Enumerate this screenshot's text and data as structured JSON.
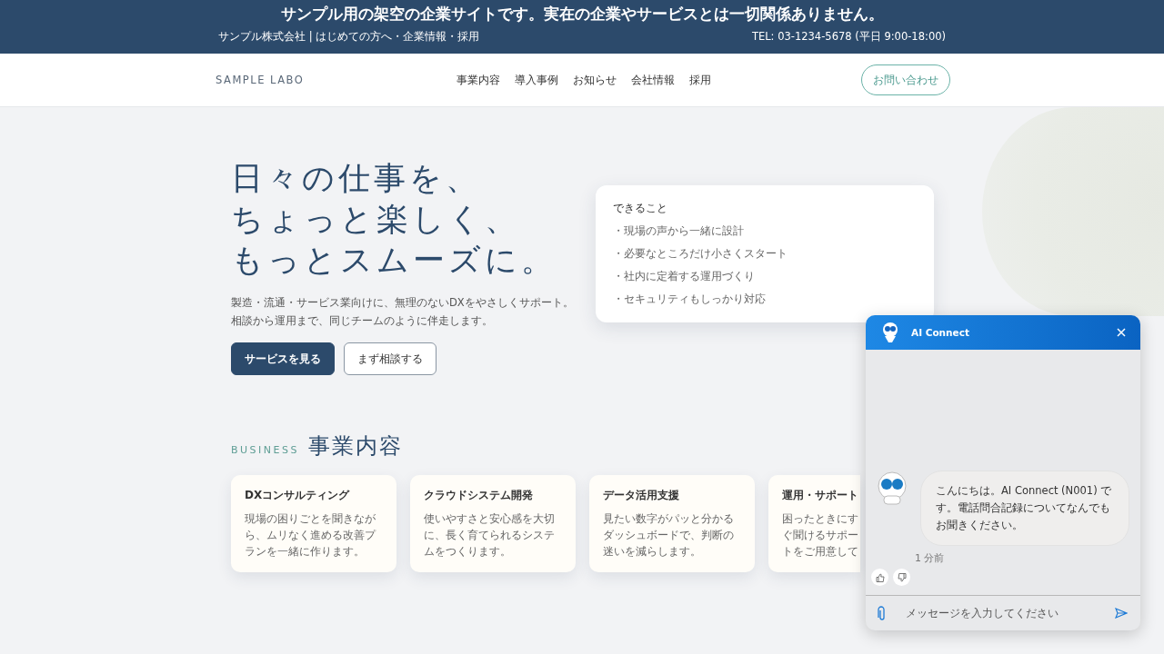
{
  "notice_banner": {
    "text": "サンプル用の架空の企業サイトです。実在の企業やサービスとは一切関係ありません。",
    "company_links": "サンプル株式会社 | はじめての方へ・企業情報・採用",
    "phone": "TEL: 03-1234-5678 (平日 9:00-18:00)"
  },
  "header": {
    "logo": "SAMPLE LABO",
    "nav": [
      "事業内容",
      "導入事例",
      "お知らせ",
      "会社情報",
      "採用"
    ],
    "contact_button": "お問い合わせ"
  },
  "hero": {
    "title_lines": [
      "日々の仕事を、",
      "ちょっと楽しく、",
      "もっとスムーズに。"
    ],
    "lead": "製造・流通・サービス業向けに、無理のないDXをやさしくサポート。相談から運用まで、同じチームのように伴走します。",
    "buttons": [
      {
        "label": "サービスを見る",
        "kind": "primary"
      },
      {
        "label": "まず相談する",
        "kind": "secondary"
      }
    ],
    "feature_card": {
      "title": "できること",
      "items": [
        "・現場の声から一緒に設計",
        "・必要なところだけ小さくスタート",
        "・社内に定着する運用づくり",
        "・セキュリティもしっかり対応"
      ]
    }
  },
  "business": {
    "eyebrow": "BUSINESS",
    "title": "事業内容",
    "cards": [
      {
        "title": "DXコンサルティング",
        "description": "現場の困りごとを聞きながら、ムリなく進める改善プランを一緒に作ります。"
      },
      {
        "title": "クラウドシステム開発",
        "description": "使いやすさと安心感を大切に、長く育てられるシステムをつくります。"
      },
      {
        "title": "データ活用支援",
        "description": "見たい数字がパッと分かるダッシュボードで、判断の迷いを減らします。"
      },
      {
        "title": "運用・サポート",
        "description": "困ったときにすぐ聞けるサポートをご用意して"
      }
    ]
  },
  "chat": {
    "title": "AI Connect",
    "message": "こんにちは。AI Connect (N001) です。電話問合記録についてなんでもお聞きください。",
    "time": "1 分前",
    "input_placeholder": "メッセージを入力してください"
  }
}
